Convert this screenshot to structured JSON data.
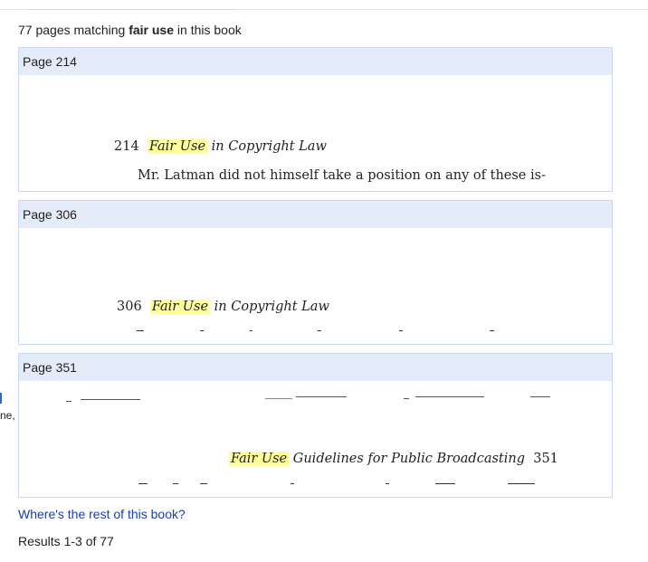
{
  "summary": {
    "prefix": "77 pages matching",
    "query": "fair use",
    "suffix": "in this book"
  },
  "results": [
    {
      "page_label": "Page 214",
      "lines": [
        {
          "num": "214",
          "highlight": "Fair Use",
          "rest": "in Copyright Law"
        },
        {
          "text": "Mr. Latman did not himself take a position on any of these is-"
        }
      ]
    },
    {
      "page_label": "Page 306",
      "lines": [
        {
          "num": "306",
          "highlight": "Fair Use",
          "rest": "in Copyright Law"
        }
      ]
    },
    {
      "page_label": "Page 351",
      "lines": [
        {
          "highlight": "Fair Use",
          "rest": "Guidelines for Public Broadcasting",
          "num": "351"
        }
      ]
    }
  ],
  "left_fragment": "ne,",
  "rest_link": "Where's the rest of this book?",
  "results_count": "Results 1-3 of 77",
  "colors": {
    "header_bg": "#e5ecf9",
    "border": "#c9d7f1",
    "highlight": "#ffff99",
    "link": "#1a3fa8"
  }
}
